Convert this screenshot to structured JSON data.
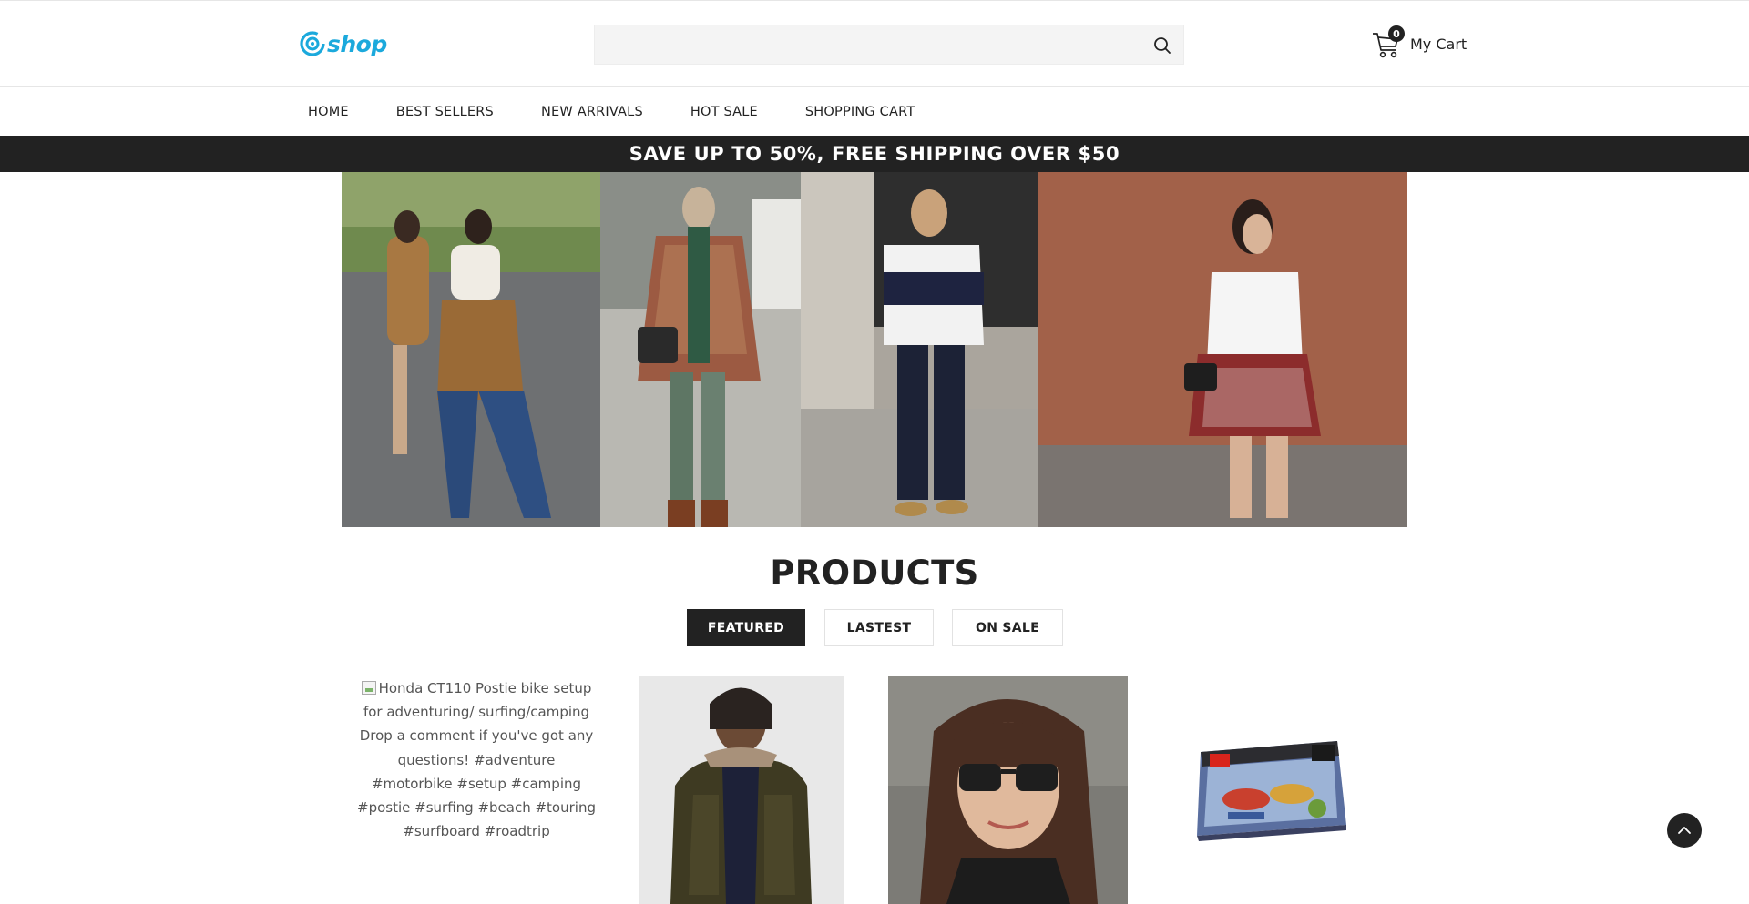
{
  "header": {
    "logo_text": "shop",
    "logo_icon": "swirl-logo-icon",
    "search": {
      "placeholder": "",
      "value": "",
      "icon": "search-icon"
    },
    "cart": {
      "count": "0",
      "label": "My Cart",
      "icon": "cart-icon"
    }
  },
  "nav": {
    "items": [
      {
        "label": "HOME"
      },
      {
        "label": "BEST SELLERS"
      },
      {
        "label": "NEW ARRIVALS"
      },
      {
        "label": "HOT SALE"
      },
      {
        "label": "SHOPPING CART"
      }
    ]
  },
  "promo": {
    "text": "SAVE UP TO 50%, FREE SHIPPING OVER $50"
  },
  "products": {
    "title": "PRODUCTS",
    "tabs": [
      {
        "label": "FEATURED",
        "active": true
      },
      {
        "label": "LASTEST",
        "active": false
      },
      {
        "label": "ON SALE",
        "active": false
      }
    ],
    "items": [
      {
        "alt": "Honda CT110 Postie bike setup for adventuring/ surfing/camping Drop a comment if you've got any questions! #adventure #motorbike #setup #camping #postie #surfing #beach #touring #surfboard #roadtrip"
      }
    ]
  },
  "colors": {
    "brand": "#1ba9dc",
    "dark": "#222222",
    "promo_bg": "#222222"
  },
  "back_to_top": {
    "icon": "chevron-up-icon"
  }
}
